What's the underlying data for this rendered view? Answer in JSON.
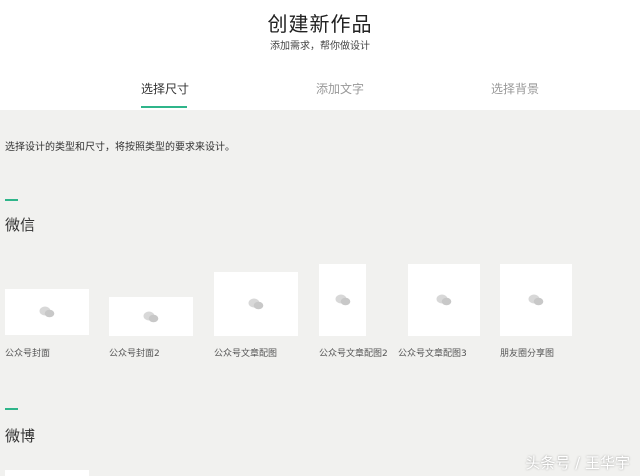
{
  "header": {
    "title": "创建新作品",
    "subtitle": "添加需求，帮你做设计"
  },
  "steps": [
    {
      "label": "选择尺寸",
      "active": true
    },
    {
      "label": "添加文字",
      "active": false
    },
    {
      "label": "选择背景",
      "active": false
    }
  ],
  "intro": "选择设计的类型和尺寸，将按照类型的要求来设计。",
  "sections": [
    {
      "title": "微信",
      "cards": [
        {
          "label": "公众号封面"
        },
        {
          "label": "公众号封面2"
        },
        {
          "label": "公众号文章配图"
        },
        {
          "label": "公众号文章配图2"
        },
        {
          "label": "公众号文章配图3"
        },
        {
          "label": "朋友圈分享图"
        }
      ]
    },
    {
      "title": "微博",
      "cards": []
    }
  ],
  "watermark": "头条号 / 王华宇",
  "colors": {
    "accent": "#2fb58a",
    "background": "#f1f1ef",
    "card": "#ffffff"
  },
  "icons": {
    "card_icon": "wechat-icon"
  }
}
